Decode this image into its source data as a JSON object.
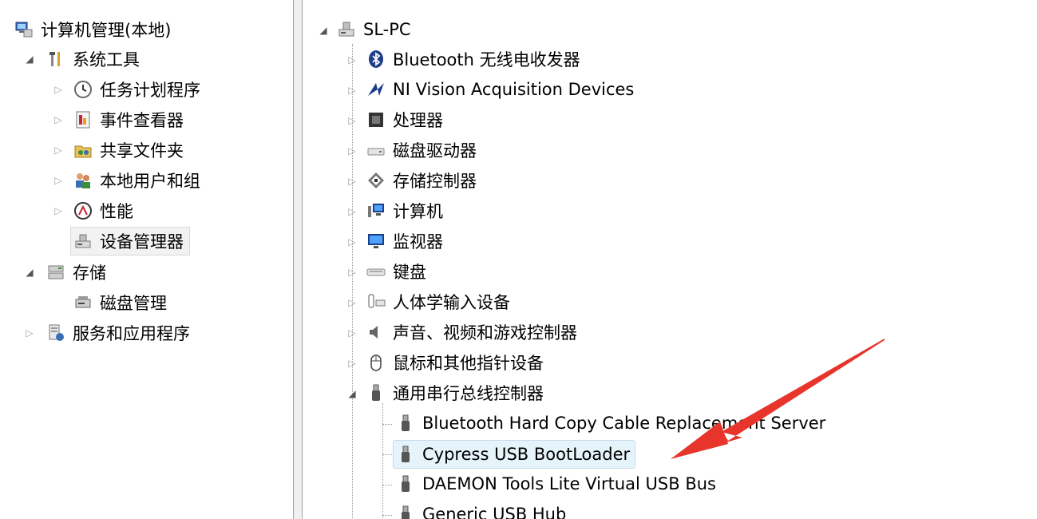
{
  "left_tree": {
    "root": {
      "label": "计算机管理(本地)",
      "icon": "computer-management-icon"
    },
    "system_tools": {
      "label": "系统工具",
      "icon": "tools-icon"
    },
    "items": [
      {
        "label": "任务计划程序",
        "icon": "clock-icon"
      },
      {
        "label": "事件查看器",
        "icon": "event-viewer-icon"
      },
      {
        "label": "共享文件夹",
        "icon": "shared-folder-icon"
      },
      {
        "label": "本地用户和组",
        "icon": "users-icon"
      },
      {
        "label": "性能",
        "icon": "performance-icon"
      },
      {
        "label": "设备管理器",
        "icon": "device-manager-icon"
      }
    ],
    "storage": {
      "label": "存储",
      "icon": "storage-icon"
    },
    "disk_management": {
      "label": "磁盘管理",
      "icon": "disk-management-icon"
    },
    "services": {
      "label": "服务和应用程序",
      "icon": "services-icon"
    }
  },
  "device_tree": {
    "root": {
      "label": "SL-PC",
      "icon": "pc-icon"
    },
    "categories": [
      {
        "label": "Bluetooth 无线电收发器",
        "icon": "bluetooth-icon"
      },
      {
        "label": "NI Vision Acquisition Devices",
        "icon": "ni-icon"
      },
      {
        "label": "处理器",
        "icon": "processor-icon"
      },
      {
        "label": "磁盘驱动器",
        "icon": "disk-drive-icon"
      },
      {
        "label": "存储控制器",
        "icon": "storage-controller-icon"
      },
      {
        "label": "计算机",
        "icon": "computer-icon"
      },
      {
        "label": "监视器",
        "icon": "monitor-icon"
      },
      {
        "label": "键盘",
        "icon": "keyboard-icon"
      },
      {
        "label": "人体学输入设备",
        "icon": "hid-icon"
      },
      {
        "label": "声音、视频和游戏控制器",
        "icon": "speaker-icon"
      },
      {
        "label": "鼠标和其他指针设备",
        "icon": "mouse-icon"
      },
      {
        "label": "通用串行总线控制器",
        "icon": "usb-icon"
      }
    ],
    "usb_children": [
      {
        "label": "Bluetooth Hard Copy Cable Replacement Server",
        "icon": "usb-icon"
      },
      {
        "label": "Cypress USB BootLoader",
        "icon": "usb-icon"
      },
      {
        "label": "DAEMON Tools Lite Virtual USB Bus",
        "icon": "usb-icon"
      },
      {
        "label": "Generic USB Hub",
        "icon": "usb-icon"
      }
    ]
  },
  "annotation": {
    "arrow_color": "#e8352b"
  }
}
